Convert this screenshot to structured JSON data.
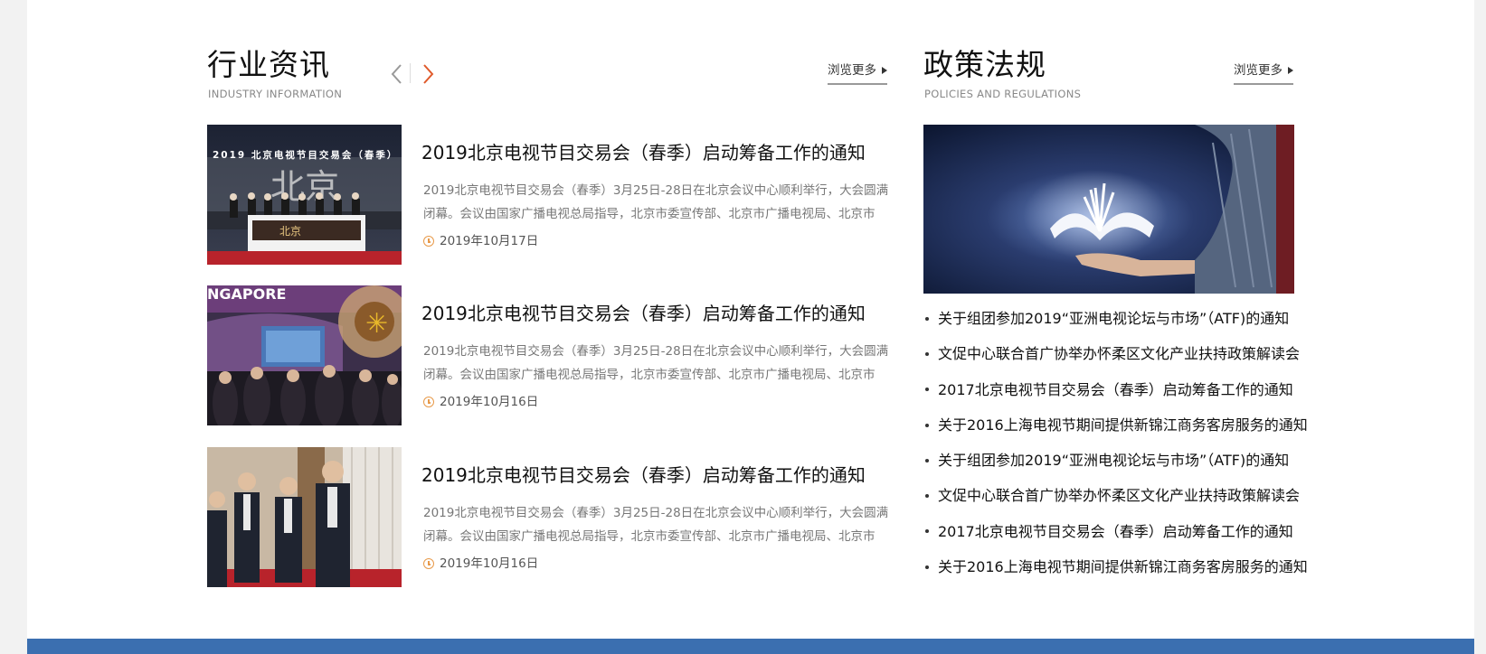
{
  "industry": {
    "title": "行业资讯",
    "subtitle": "INDUSTRY INFORMATION",
    "more_label": "浏览更多",
    "items": [
      {
        "title": "2019北京电视节目交易会（春季）启动筹备工作的通知",
        "desc": "2019北京电视节目交易会（春季）3月25日-28日在北京会议中心顺利举行，大会圆满闭幕。会议由国家广播电视总局指导，北京市委宣传部、北京市广播电视局、北京市怀......",
        "date": "2019年10月17日",
        "banner_text": "2019 北京电视节目交易会（春季）"
      },
      {
        "title": "2019北京电视节目交易会（春季）启动筹备工作的通知",
        "desc": "2019北京电视节目交易会（春季）3月25日-28日在北京会议中心顺利举行，大会圆满闭幕。会议由国家广播电视总局指导，北京市委宣传部、北京市广播电视局、北京市怀......",
        "date": "2019年10月16日",
        "banner_text": "NGAPORE"
      },
      {
        "title": "2019北京电视节目交易会（春季）启动筹备工作的通知",
        "desc": "2019北京电视节目交易会（春季）3月25日-28日在北京会议中心顺利举行，大会圆满闭幕。会议由国家广播电视总局指导，北京市委宣传部、北京市广播电视局、北京市怀......",
        "date": "2019年10月16日"
      }
    ]
  },
  "policy": {
    "title": "政策法规",
    "subtitle": "POLICIES AND REGULATIONS",
    "more_label": "浏览更多",
    "items": [
      "关于组团参加2019“亚洲电视论坛与市场”（ATF)的通知",
      "文促中心联合首广协举办怀柔区文化产业扶持政策解读会",
      "2017北京电视节目交易会（春季）启动筹备工作的通知",
      "关于2016上海电视节期间提供新锦江商务客房服务的通知",
      "关于组团参加2019“亚洲电视论坛与市场”（ATF)的通知",
      "文促中心联合首广协举办怀柔区文化产业扶持政策解读会",
      "2017北京电视节目交易会（春季）启动筹备工作的通知",
      "关于2016上海电视节期间提供新锦江商务客房服务的通知"
    ]
  },
  "colors": {
    "accent_arrow": "#e05a2b",
    "clock": "#e89a4a",
    "footer": "#3b6fb0"
  }
}
